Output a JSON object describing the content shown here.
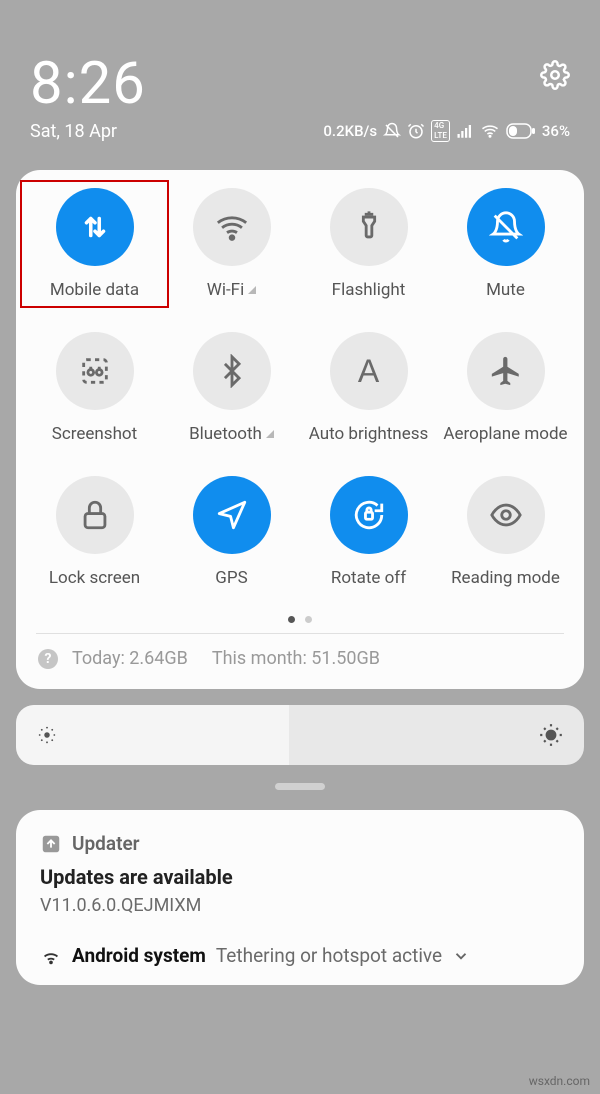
{
  "header": {
    "time": "8:26",
    "date": "Sat, 18 Apr"
  },
  "status": {
    "speed": "0.2KB/s",
    "lte_label": "4G LTE",
    "battery_pct": "36%"
  },
  "tiles": [
    {
      "label": "Mobile data",
      "active": true,
      "icon": "arrows-updown",
      "highlighted": true,
      "indicator": false
    },
    {
      "label": "Wi-Fi",
      "active": false,
      "icon": "wifi",
      "highlighted": false,
      "indicator": true
    },
    {
      "label": "Flashlight",
      "active": false,
      "icon": "flashlight",
      "highlighted": false,
      "indicator": false
    },
    {
      "label": "Mute",
      "active": true,
      "icon": "mute",
      "highlighted": false,
      "indicator": false
    },
    {
      "label": "Screenshot",
      "active": false,
      "icon": "screenshot",
      "highlighted": false,
      "indicator": false
    },
    {
      "label": "Bluetooth",
      "active": false,
      "icon": "bluetooth",
      "highlighted": false,
      "indicator": true
    },
    {
      "label": "Auto brightness",
      "active": false,
      "icon": "auto-bright",
      "highlighted": false,
      "indicator": false
    },
    {
      "label": "Aeroplane mode",
      "active": false,
      "icon": "airplane",
      "highlighted": false,
      "indicator": false
    },
    {
      "label": "Lock screen",
      "active": false,
      "icon": "lock",
      "highlighted": false,
      "indicator": false
    },
    {
      "label": "GPS",
      "active": true,
      "icon": "gps",
      "highlighted": false,
      "indicator": false
    },
    {
      "label": "Rotate off",
      "active": true,
      "icon": "rotate-lock",
      "highlighted": false,
      "indicator": false
    },
    {
      "label": "Reading mode",
      "active": false,
      "icon": "eye",
      "highlighted": false,
      "indicator": false
    }
  ],
  "pager": {
    "page": 0,
    "count": 2
  },
  "usage": {
    "today_label": "Today:",
    "today_value": "2.64GB",
    "month_label": "This month:",
    "month_value": "51.50GB"
  },
  "notification": {
    "app_name": "Updater",
    "title": "Updates are available",
    "subtitle": "V11.0.6.0.QEJMIXM",
    "second_app": "Android system",
    "second_text": "Tethering or hotspot active"
  },
  "watermark": "wsxdn.com"
}
